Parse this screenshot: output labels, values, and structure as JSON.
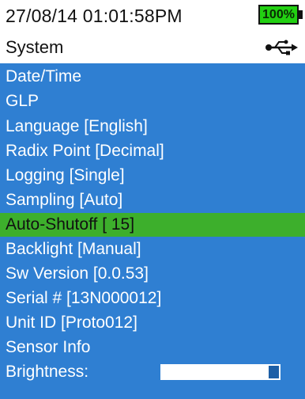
{
  "status": {
    "datetime": "27/08/14  01:01:58PM",
    "battery_label": "100%",
    "battery_color": "#22d012"
  },
  "header": {
    "title": "System",
    "connection_icon": "usb-icon"
  },
  "menu": {
    "items": [
      {
        "label": "Date/Time"
      },
      {
        "label": "GLP"
      },
      {
        "label": "Language [English]"
      },
      {
        "label": "Radix Point [Decimal]"
      },
      {
        "label": "Logging [Single]"
      },
      {
        "label": "Sampling [Auto]"
      },
      {
        "label": "Auto-Shutoff [ 15]",
        "selected": true
      },
      {
        "label": "Backlight [Manual]"
      },
      {
        "label": "Sw Version [0.0.53]"
      },
      {
        "label": "Serial # [13N000012]"
      },
      {
        "label": "Unit ID [Proto012]"
      },
      {
        "label": "Sensor Info"
      },
      {
        "label": "Brightness:"
      }
    ],
    "brightness_level": 0.91
  },
  "colors": {
    "menu_background": "#2f7fd2",
    "selected_background": "#3daf2c",
    "menu_text": "#ffffff",
    "selected_text": "#111111"
  }
}
